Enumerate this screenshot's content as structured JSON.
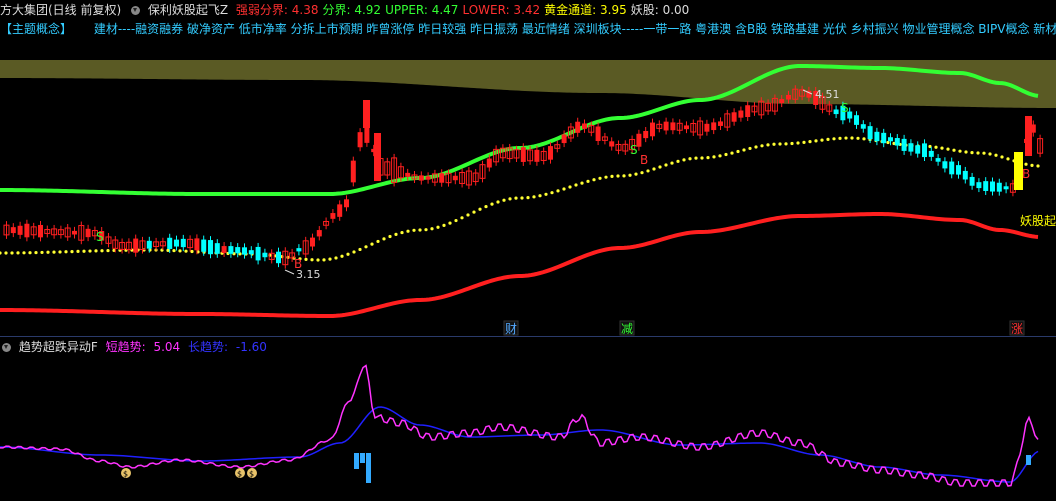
{
  "header": {
    "stock_name": "方大集团(日线 前复权)",
    "indicator_name": "保利妖股起飞Z",
    "values": [
      {
        "label": "强弱分界:",
        "value": "4.38",
        "color": "#ff3030"
      },
      {
        "label": "分界:",
        "value": "4.92",
        "color": "#33ff33"
      },
      {
        "label": "UPPER:",
        "value": "4.47",
        "color": "#33ff33"
      },
      {
        "label": "LOWER:",
        "value": "3.42",
        "color": "#ff3030"
      },
      {
        "label": "黄金通道:",
        "value": "3.95",
        "color": "#ffff00"
      },
      {
        "label": "妖股:",
        "value": "0.00",
        "color": "#dddddd"
      }
    ]
  },
  "concepts": {
    "title": "【主题概念】",
    "text": "建材----融资融券 破净资产 低市净率 分拆上市预期 昨曾涨停 昨日较强 昨日振荡 最近情绪 深圳板块-----一带一路 粤港澳 含B股 铁路基建 光伏 乡村振兴 物业管理概念 BIPV概念 新材料"
  },
  "main_chart": {
    "annotations": {
      "low_price": "3.15",
      "high_price": "4.51",
      "yaogu_label": "妖股起",
      "s_mark": "S",
      "b_mark": "B"
    },
    "bottom_markers": [
      {
        "text": "财",
        "color": "#55aaff"
      },
      {
        "text": "减",
        "color": "#33ff33"
      },
      {
        "text": "涨",
        "color": "#ff3030"
      }
    ]
  },
  "indicator": {
    "name": "趋势超跌异动F",
    "short_label": "短趋势:",
    "short_value": "5.04",
    "short_color": "#ff33ff",
    "long_label": "长趋势:",
    "long_value": "-1.60",
    "long_color": "#3333ff"
  }
}
